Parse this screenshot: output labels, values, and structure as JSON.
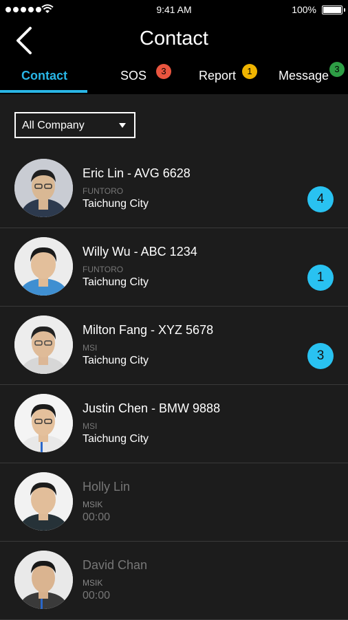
{
  "status_bar": {
    "time": "9:41 AM",
    "battery": "100%"
  },
  "header": {
    "title": "Contact"
  },
  "tabs": [
    {
      "label": "Contact",
      "badge": ""
    },
    {
      "label": "SOS",
      "badge": "3",
      "badge_color": "#e9553f"
    },
    {
      "label": "Report",
      "badge": "1",
      "badge_color": "#f0b400"
    },
    {
      "label": "Message",
      "badge": "3",
      "badge_color": "#2e9e45"
    }
  ],
  "filter": {
    "label": "All Company"
  },
  "contacts": [
    {
      "name": "Eric Lin - AVG 6628",
      "company": "FUNTORO",
      "city": "Taichung City",
      "count": "4",
      "online": true
    },
    {
      "name": "Willy Wu - ABC 1234",
      "company": "FUNTORO",
      "city": "Taichung City",
      "count": "1",
      "online": true
    },
    {
      "name": "Milton Fang - XYZ 5678",
      "company": "MSI",
      "city": "Taichung City",
      "count": "3",
      "online": true
    },
    {
      "name": "Justin Chen - BMW 9888",
      "company": "MSI",
      "city": "Taichung City",
      "count": "",
      "online": true
    },
    {
      "name": "Holly Lin",
      "company": "MSIK",
      "city": "00:00",
      "count": "",
      "online": false
    },
    {
      "name": "David Chan",
      "company": "MSIK",
      "city": "00:00",
      "count": "",
      "online": false
    }
  ],
  "colors": {
    "accent": "#29b6e6",
    "count_badge": "#29c2f1",
    "background": "#1c1c1c"
  }
}
